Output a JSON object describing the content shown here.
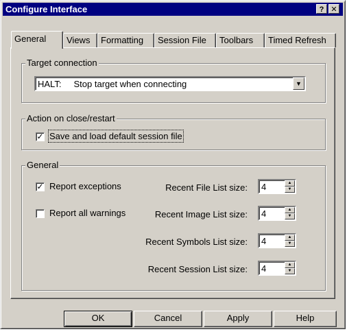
{
  "window": {
    "title": "Configure Interface",
    "help_glyph": "?",
    "close_glyph": "✕"
  },
  "tabs": [
    {
      "label": "General",
      "active": true
    },
    {
      "label": "Views"
    },
    {
      "label": "Formatting"
    },
    {
      "label": "Session File"
    },
    {
      "label": "Toolbars"
    },
    {
      "label": "Timed Refresh"
    }
  ],
  "target_connection": {
    "group_label": "Target connection",
    "selected": "HALT:     Stop target when connecting"
  },
  "action_close": {
    "group_label": "Action on close/restart",
    "checkbox_label": "Save and load default session file",
    "checked": true
  },
  "general": {
    "group_label": "General",
    "report_exceptions": {
      "label": "Report exceptions",
      "checked": true
    },
    "report_warnings": {
      "label": "Report all warnings",
      "checked": false
    },
    "recent_file": {
      "label": "Recent File List size:",
      "value": "4"
    },
    "recent_image": {
      "label": "Recent Image List size:",
      "value": "4"
    },
    "recent_symbols": {
      "label": "Recent Symbols List size:",
      "value": "4"
    },
    "recent_session": {
      "label": "Recent Session List size:",
      "value": "4"
    }
  },
  "check_glyph": "✓",
  "buttons": {
    "ok": "OK",
    "cancel": "Cancel",
    "apply": "Apply",
    "help": "Help"
  }
}
